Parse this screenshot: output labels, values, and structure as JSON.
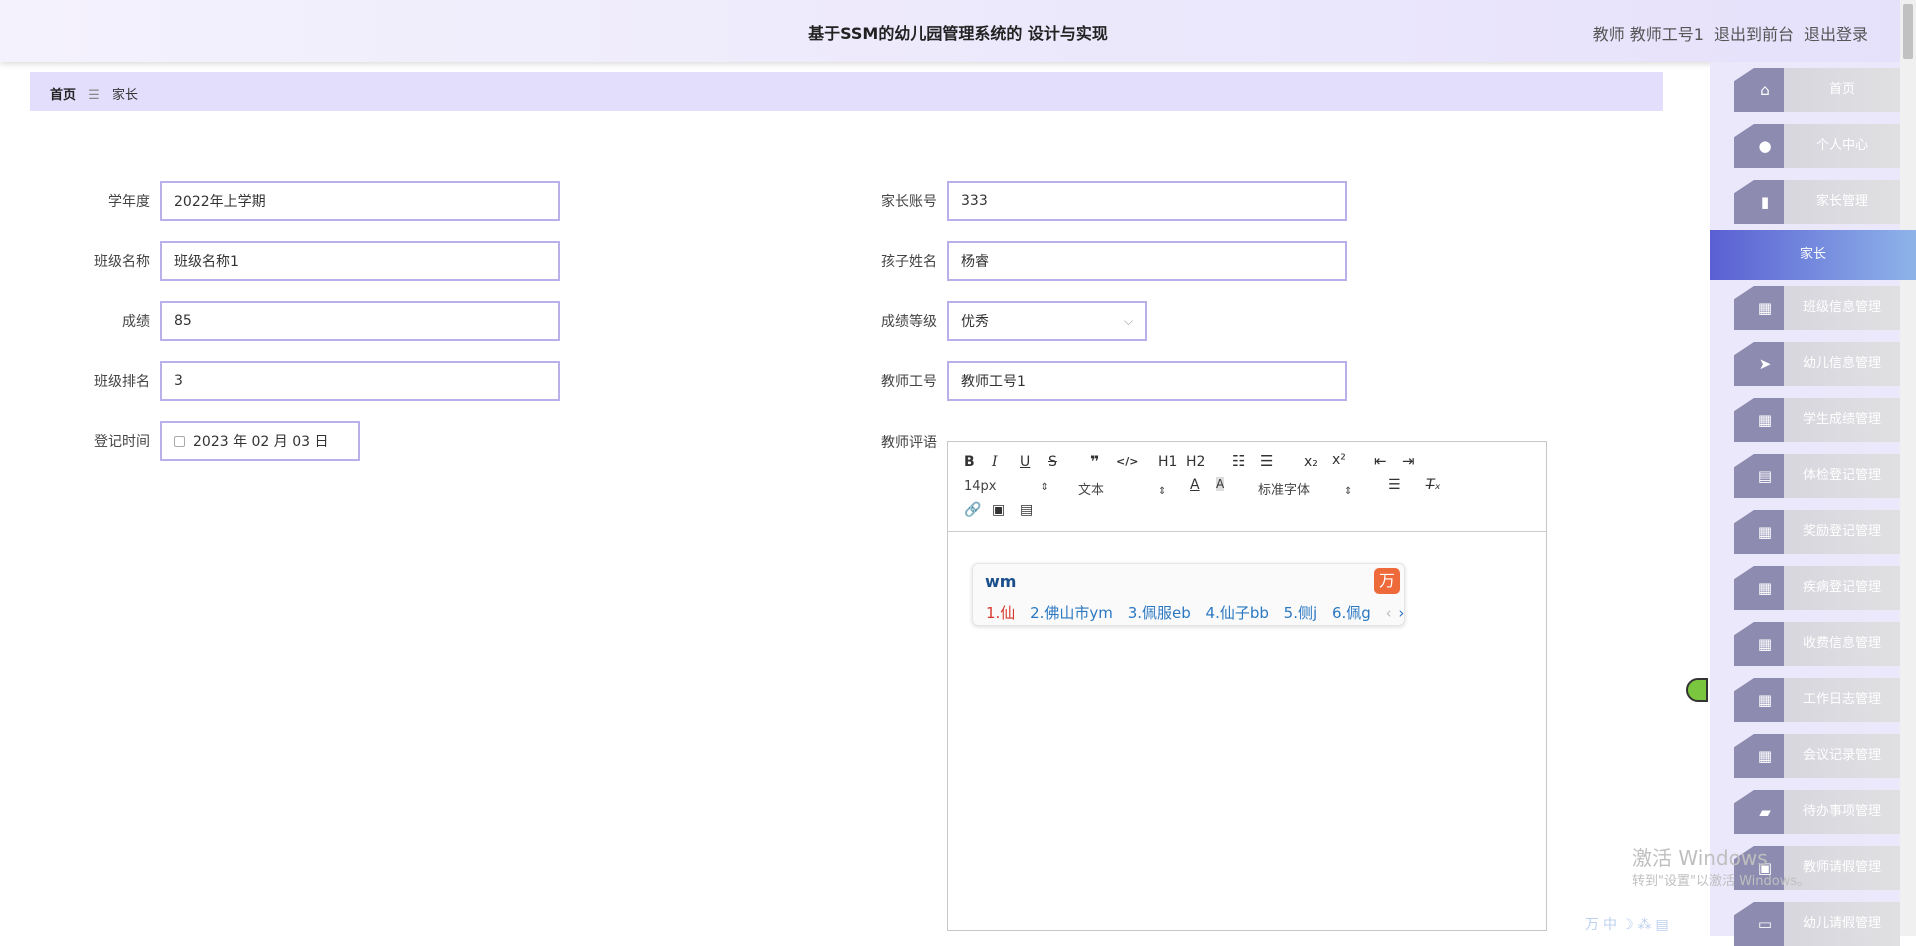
{
  "header": {
    "title": "基于SSM的幼儿园管理系统的 设计与实现",
    "user": "教师 教师工号1",
    "front_link": "退出到前台",
    "logout_link": "退出登录"
  },
  "breadcrumb": {
    "home": "首页",
    "sep_icon": "menu-icon",
    "current": "家长"
  },
  "form": {
    "school_year": {
      "label": "学年度",
      "value": "2022年上学期"
    },
    "class_name": {
      "label": "班级名称",
      "value": "班级名称1"
    },
    "score": {
      "label": "成绩",
      "value": "85"
    },
    "class_rank": {
      "label": "班级排名",
      "value": "3"
    },
    "register_time": {
      "label": "登记时间",
      "value": "2023 年 02 月 03 日"
    },
    "parent_account": {
      "label": "家长账号",
      "value": "333"
    },
    "child_name": {
      "label": "孩子姓名",
      "value": "杨睿"
    },
    "score_level": {
      "label": "成绩等级",
      "value": "优秀"
    },
    "teacher_id": {
      "label": "教师工号",
      "value": "教师工号1"
    },
    "teacher_comment": {
      "label": "教师评语"
    }
  },
  "editor_toolbar": {
    "font_size": "14px",
    "header_type": "文本",
    "font_family": "标准字体",
    "h1": "H1",
    "h2": "H2"
  },
  "ime": {
    "code": "wm",
    "candidates": [
      "1.仙",
      "2.佛山市ym",
      "3.佩服eb",
      "4.仙子bb",
      "5.侧j",
      "6.佩g"
    ]
  },
  "sidebar": {
    "items": [
      {
        "label": "首页",
        "icon": "home-icon"
      },
      {
        "label": "个人中心",
        "icon": "user-icon"
      },
      {
        "label": "家长管理",
        "icon": "chart-icon"
      },
      {
        "label": "家长",
        "icon": "",
        "active": true
      },
      {
        "label": "班级信息管理",
        "icon": "grid-icon"
      },
      {
        "label": "幼儿信息管理",
        "icon": "send-icon"
      },
      {
        "label": "学生成绩管理",
        "icon": "grid-icon"
      },
      {
        "label": "体检登记管理",
        "icon": "clipboard-icon"
      },
      {
        "label": "奖励登记管理",
        "icon": "grid-icon"
      },
      {
        "label": "疾病登记管理",
        "icon": "grid-icon"
      },
      {
        "label": "收费信息管理",
        "icon": "grid-icon"
      },
      {
        "label": "工作日志管理",
        "icon": "grid-icon"
      },
      {
        "label": "会议记录管理",
        "icon": "grid-icon"
      },
      {
        "label": "待办事项管理",
        "icon": "briefcase-icon"
      },
      {
        "label": "教师请假管理",
        "icon": "calendar-icon"
      },
      {
        "label": "幼儿请假管理",
        "icon": "monitor-icon"
      }
    ]
  },
  "watermark": {
    "line1": "激活 Windows",
    "line2": "转到\"设置\"以激活 Windows。"
  },
  "colors": {
    "accent": "#5a5fd2",
    "input_border": "#b7b0e9",
    "breadcrumb_bg": "#e3defb"
  }
}
